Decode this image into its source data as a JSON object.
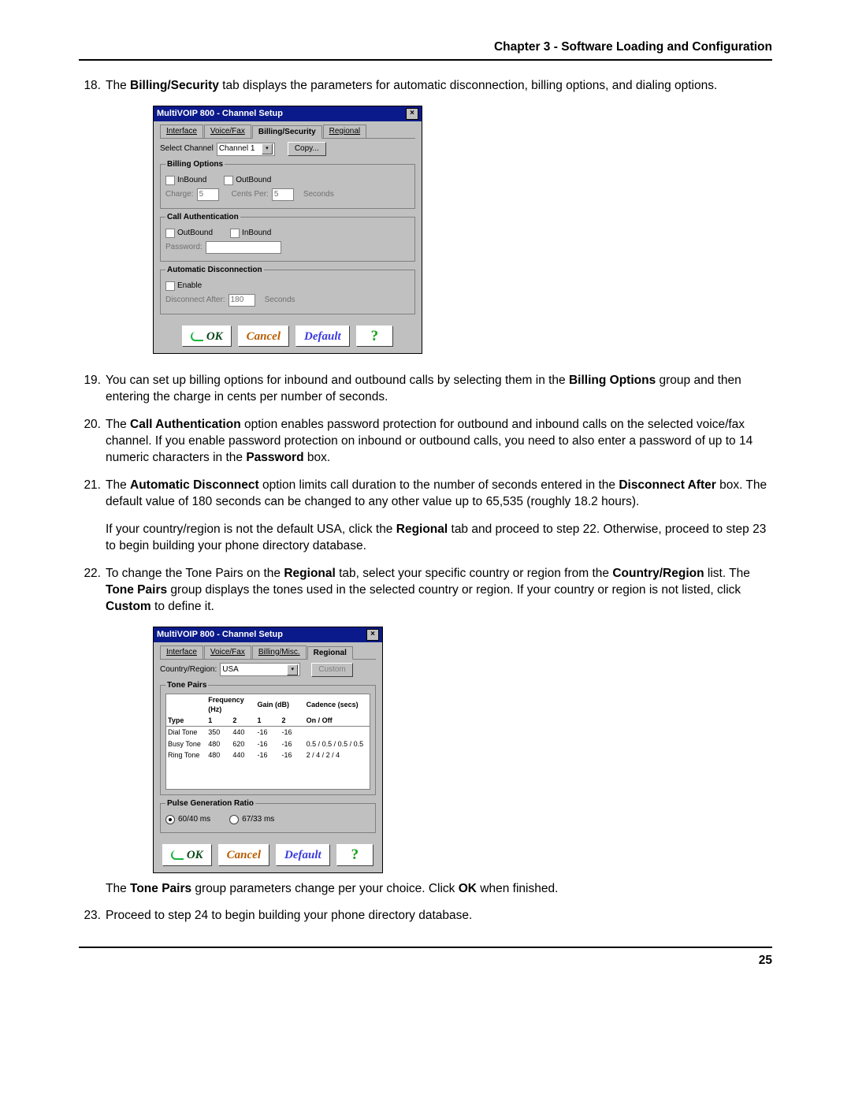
{
  "header": {
    "title": "Chapter 3 - Software Loading and Configuration"
  },
  "footer": {
    "page_number": "25"
  },
  "steps": {
    "s18": {
      "num": "18.",
      "text_before_bold": "The ",
      "bold1": "Billing/Security",
      "text_after": " tab displays the parameters for automatic disconnection, billing options, and dialing options."
    },
    "s19": {
      "num": "19.",
      "text1": "You can set up billing options for inbound and outbound calls by selecting them in the ",
      "bold1": "Billing Options",
      "text2": " group and then entering the charge in cents per number of seconds."
    },
    "s20": {
      "num": "20.",
      "text1": "The ",
      "bold1": "Call Authentication",
      "text2": " option enables password protection for outbound and inbound calls on the selected voice/fax channel.  If you enable password protection on inbound or outbound calls, you need to also enter a password of up to 14 numeric characters in the ",
      "bold2": "Password",
      "text3": " box."
    },
    "s21": {
      "num": "21.",
      "p1_text1": "The ",
      "p1_bold1": "Automatic Disconnect",
      "p1_text2": " option limits call duration to the number of seconds entered in the ",
      "p1_bold2": "Disconnect After",
      "p1_text3": " box.  The default value of 180 seconds can be changed to any other value up to 65,535 (roughly 18.2 hours).",
      "p2_text1": "If your country/region is not the default USA, click the ",
      "p2_bold1": "Regional",
      "p2_text2": " tab and proceed to step 22.  Otherwise, proceed to step 23 to begin building your phone directory database."
    },
    "s22": {
      "num": "22.",
      "p1_text1": "To change the Tone Pairs on the ",
      "p1_bold1": "Regional",
      "p1_text2": " tab, select your specific country or region from the ",
      "p1_bold2": "Country/Region",
      "p1_text3": " list.  The ",
      "p1_bold3": "Tone Pairs",
      "p1_text4": " group displays the tones used in the selected country or region.  If your country or region is not listed, click ",
      "p1_bold4": "Custom",
      "p1_text5": " to define it.",
      "p2_text1": "The ",
      "p2_bold1": "Tone Pairs",
      "p2_text2": " group parameters change per your choice.  Click ",
      "p2_bold2": "OK",
      "p2_text3": " when finished."
    },
    "s23": {
      "num": "23.",
      "text": "Proceed to step 24 to begin building your phone directory database."
    }
  },
  "dialog1": {
    "title": "MultiVOIP 800 - Channel Setup",
    "tabs": {
      "t1": "Interface",
      "t2": "Voice/Fax",
      "t3": "Billing/Security",
      "t4": "Regional"
    },
    "select_channel_label": "Select Channel",
    "select_channel_value": "Channel 1",
    "copy_btn": "Copy...",
    "billing_legend": "Billing Options",
    "cb_inbound": "InBound",
    "cb_outbound": "OutBound",
    "charge_label": "Charge:",
    "charge_value": "5",
    "cents_per_label": "Cents Per:",
    "cents_per_value": "5",
    "seconds_suffix": "Seconds",
    "auth_legend": "Call Authentication",
    "auth_outbound": "OutBound",
    "auth_inbound": "InBound",
    "password_label": "Password:",
    "password_value": "",
    "disc_legend": "Automatic Disconnection",
    "disc_enable": "Enable",
    "disc_after_label": "Disconnect After:",
    "disc_after_value": "180",
    "btn_ok": "OK",
    "btn_cancel": "Cancel",
    "btn_default": "Default",
    "btn_help": "?"
  },
  "dialog2": {
    "title": "MultiVOIP 800 - Channel Setup",
    "tabs": {
      "t1": "Interface",
      "t2": "Voice/Fax",
      "t3": "Billing/Misc.",
      "t4": "Regional"
    },
    "country_label": "Country/Region:",
    "country_value": "USA",
    "custom_btn": "Custom",
    "tone_pairs_legend": "Tone Pairs",
    "col_type": "Type",
    "col_freq": "Frequency (Hz)",
    "col_gain": "Gain (dB)",
    "col_cadence": "Cadence (secs)",
    "sub1": "1",
    "sub2": "2",
    "sub_onoff": "On / Off",
    "rows": [
      {
        "type": "Dial Tone",
        "f1": "350",
        "f2": "440",
        "g1": "-16",
        "g2": "-16",
        "cad": ""
      },
      {
        "type": "Busy Tone",
        "f1": "480",
        "f2": "620",
        "g1": "-16",
        "g2": "-16",
        "cad": "0.5 / 0.5 / 0.5 / 0.5"
      },
      {
        "type": "Ring Tone",
        "f1": "480",
        "f2": "440",
        "g1": "-16",
        "g2": "-16",
        "cad": "2 / 4 / 2 / 4"
      }
    ],
    "pulse_legend": "Pulse Generation Ratio",
    "radio1": "60/40 ms",
    "radio2": "67/33 ms",
    "btn_ok": "OK",
    "btn_cancel": "Cancel",
    "btn_default": "Default",
    "btn_help": "?"
  }
}
